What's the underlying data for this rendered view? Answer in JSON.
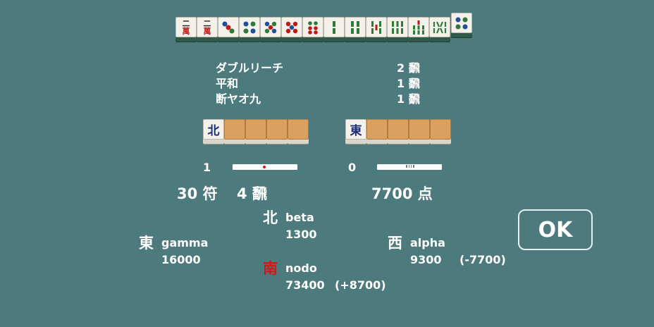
{
  "hand_tiles": [
    {
      "icon": "man-2-tile",
      "glyph": "二",
      "sub": "萬"
    },
    {
      "icon": "man-2-tile",
      "glyph": "二",
      "sub": "萬"
    },
    {
      "icon": "pin-3-tile",
      "glyph": "●",
      "sub": ""
    },
    {
      "icon": "pin-4-tile",
      "glyph": "●",
      "sub": ""
    },
    {
      "icon": "pin-5-tile",
      "glyph": "●",
      "sub": ""
    },
    {
      "icon": "pin-5-red-tile",
      "glyph": "●",
      "sub": ""
    },
    {
      "icon": "pin-6-tile",
      "glyph": "●",
      "sub": ""
    },
    {
      "icon": "sou-2-tile",
      "glyph": "‖",
      "sub": ""
    },
    {
      "icon": "sou-4-tile",
      "glyph": "‖",
      "sub": ""
    },
    {
      "icon": "sou-5-tile",
      "glyph": "‖",
      "sub": ""
    },
    {
      "icon": "sou-6-tile",
      "glyph": "‖",
      "sub": ""
    },
    {
      "icon": "sou-7-tile",
      "glyph": "‖",
      "sub": ""
    },
    {
      "icon": "sou-8-tile",
      "glyph": "‖",
      "sub": ""
    }
  ],
  "winning_tile": {
    "icon": "pin-4-tile"
  },
  "yaku": [
    {
      "name": "ダブルリーチ",
      "han": "2 飜"
    },
    {
      "name": "平和",
      "han": "1 飜"
    },
    {
      "name": "断ヤオ九",
      "han": "1 飜"
    }
  ],
  "dora": {
    "tile": "北",
    "icon": "north-wind-tile"
  },
  "uradora": {
    "tile": "東",
    "icon": "east-wind-tile"
  },
  "honba": {
    "count": "1"
  },
  "riichi": {
    "count": "0"
  },
  "fu_han": {
    "fu": "30 符",
    "han": "4 飜"
  },
  "points": "7700 点",
  "players": {
    "north": {
      "wind": "北",
      "name": "beta",
      "score": "1300",
      "delta": ""
    },
    "east": {
      "wind": "東",
      "name": "gamma",
      "score": "16000",
      "delta": ""
    },
    "west": {
      "wind": "西",
      "name": "alpha",
      "score": "9300",
      "delta": "(-7700)"
    },
    "south": {
      "wind": "南",
      "name": "nodo",
      "score": "73400",
      "delta": "(+8700)"
    }
  },
  "colors": {
    "background": "#4d7a7c",
    "winner_wind": "#d01818"
  },
  "ok_label": "OK"
}
